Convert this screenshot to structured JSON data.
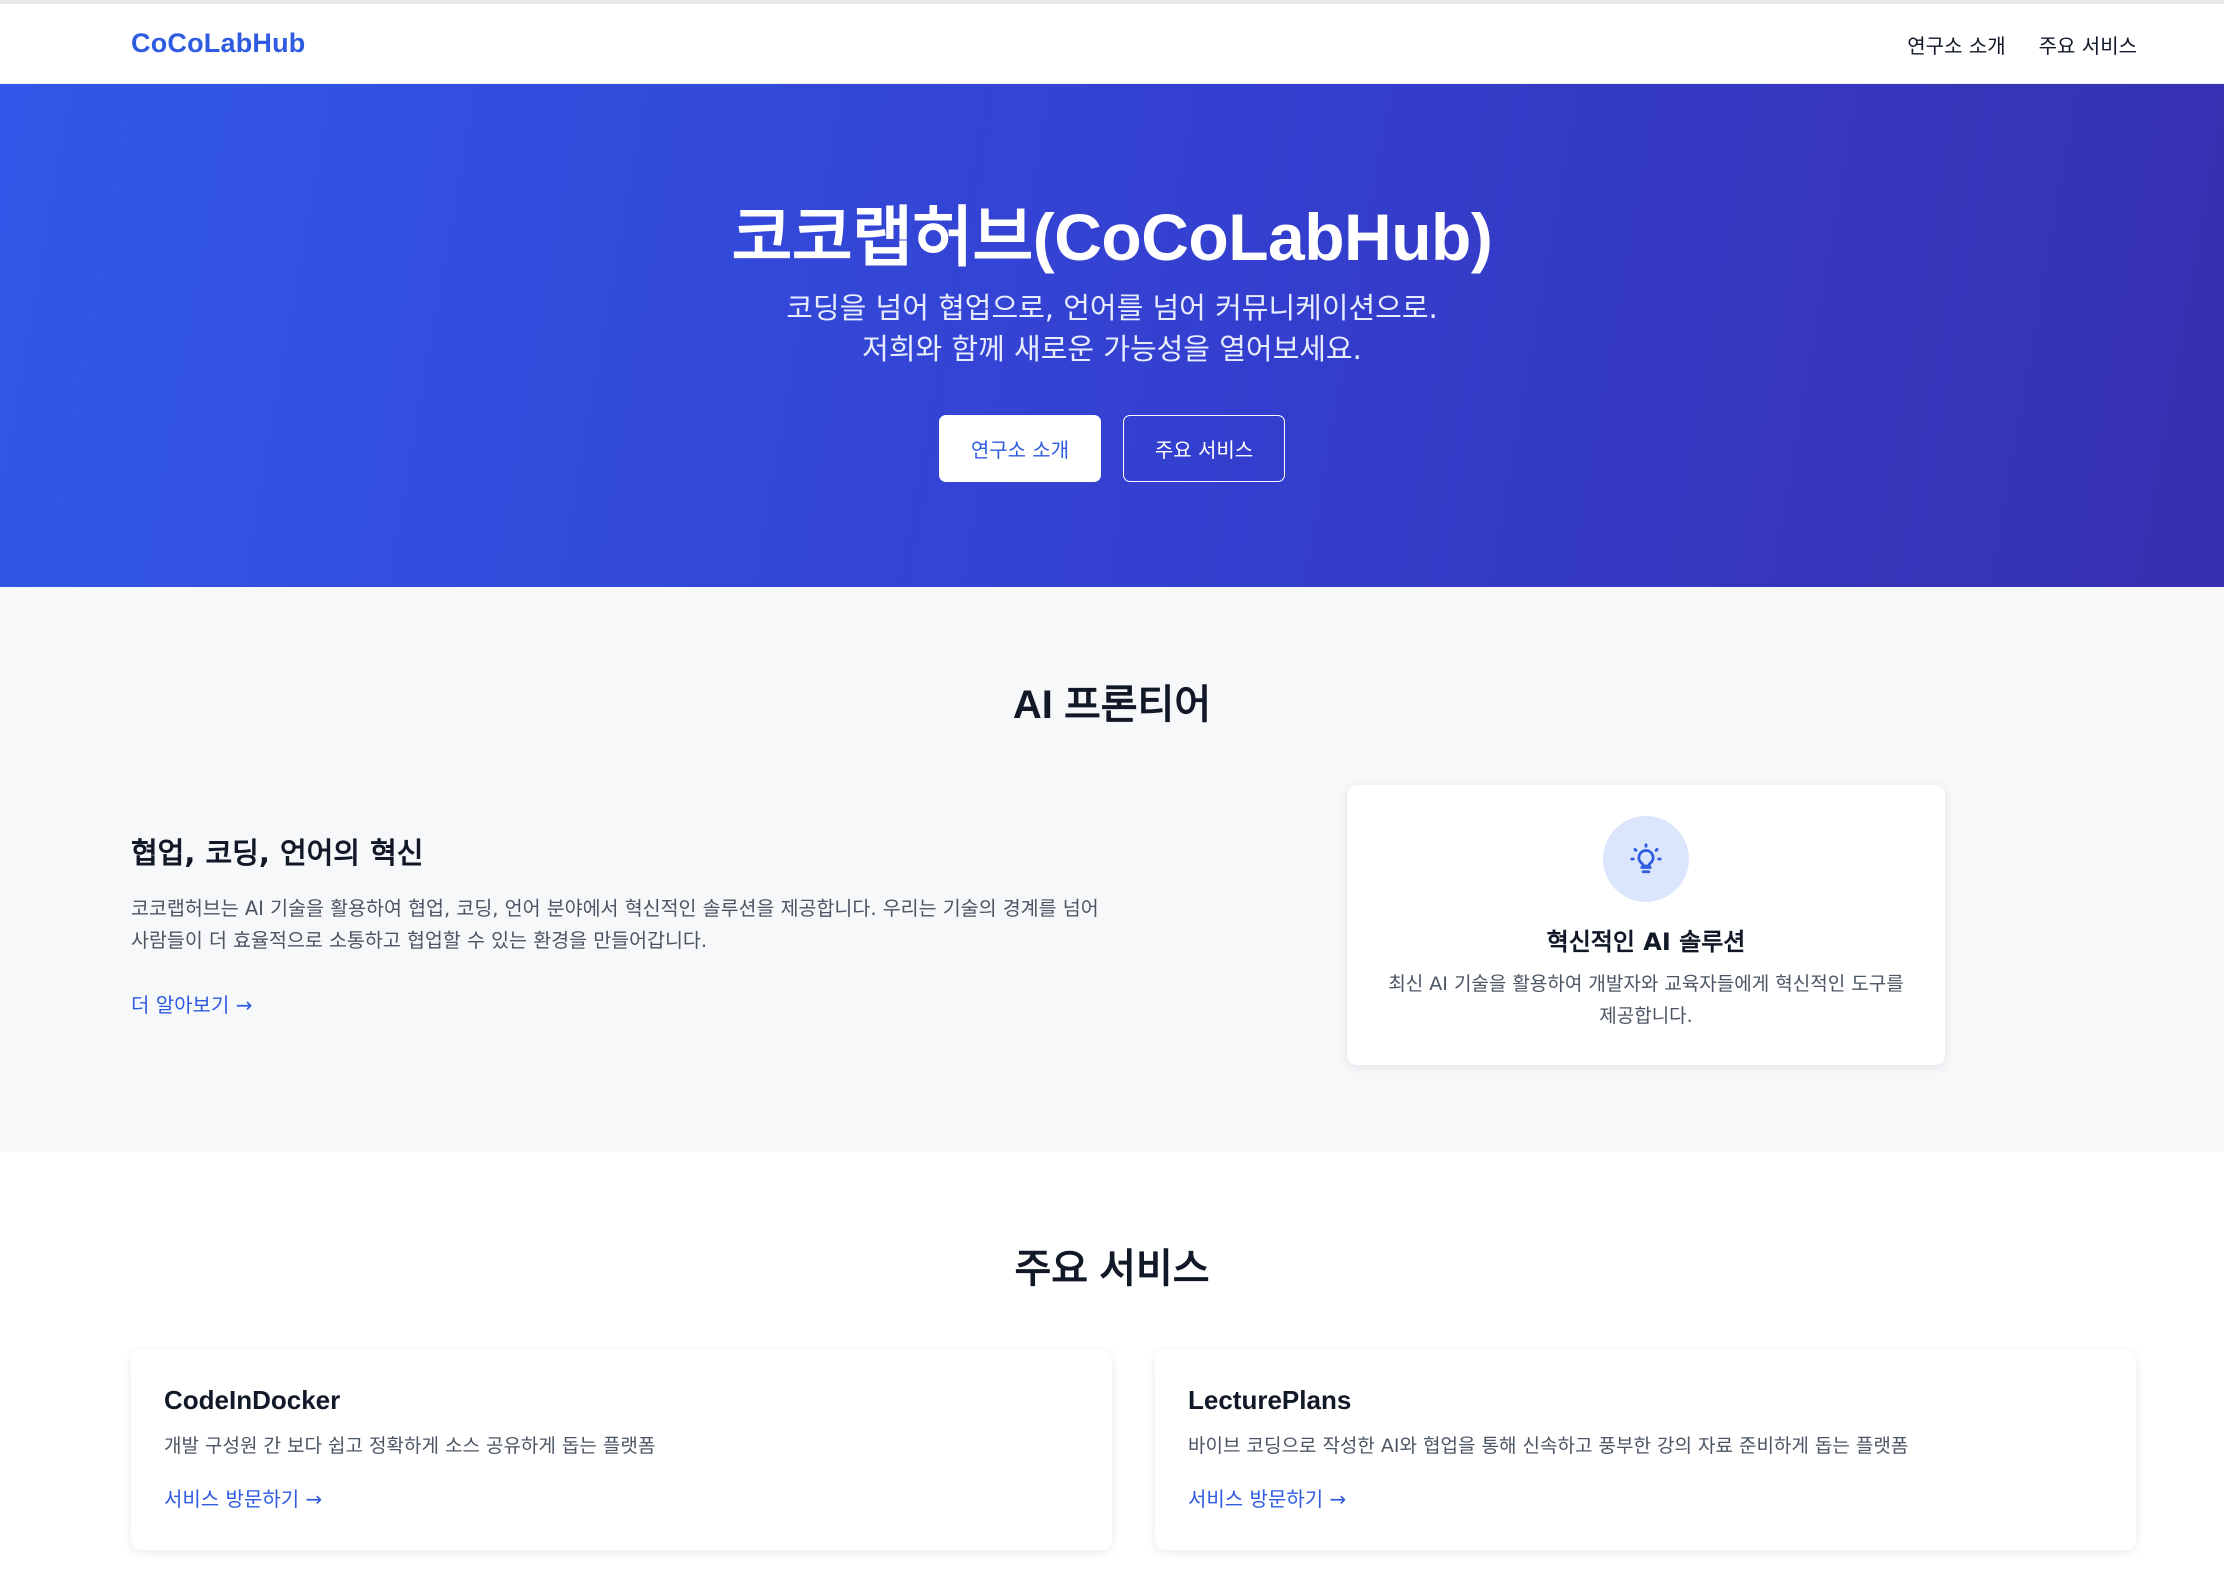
{
  "header": {
    "brand": "CoCoLabHub",
    "nav": [
      "연구소 소개",
      "주요 서비스"
    ]
  },
  "hero": {
    "title": "코코랩허브(CoCoLabHub)",
    "subtitle_line1": "코딩을 넘어 협업으로, 언어를 넘어 커뮤니케이션으로.",
    "subtitle_line2": "저희와 함께 새로운 가능성을 열어보세요.",
    "primary_button": "연구소 소개",
    "secondary_button": "주요 서비스"
  },
  "frontier": {
    "title": "AI 프론티어",
    "heading": "협업, 코딩, 언어의 혁신",
    "description": "코코랩허브는 AI 기술을 활용하여 협업, 코딩, 언어 분야에서 혁신적인 솔루션을 제공합니다. 우리는 기술의 경계를 넘어 사람들이 더 효율적으로 소통하고 협업할 수 있는 환경을 만들어갑니다.",
    "link": "더 알아보기 →",
    "card": {
      "icon": "lightbulb-icon",
      "title": "혁신적인 AI 솔루션",
      "description": "최신 AI 기술을 활용하여 개발자와 교육자들에게 혁신적인 도구를 제공합니다."
    }
  },
  "services": {
    "title": "주요 서비스",
    "items": [
      {
        "name": "CodeInDocker",
        "description": "개발 구성원 간 보다 쉽고 정확하게 소스 공유하게 돕는 플랫폼",
        "link": "서비스 방문하기 →"
      },
      {
        "name": "LecturePlans",
        "description": "바이브 코딩으로 작성한 AI와 협업을 통해 신속하고 풍부한 강의 자료 준비하게 돕는 플랫폼",
        "link": "서비스 방문하기 →"
      }
    ]
  },
  "colors": {
    "accent": "#2f5be0",
    "hero_start": "#3158e8",
    "hero_end": "#3730b0",
    "section_bg": "#f7f8fa"
  }
}
